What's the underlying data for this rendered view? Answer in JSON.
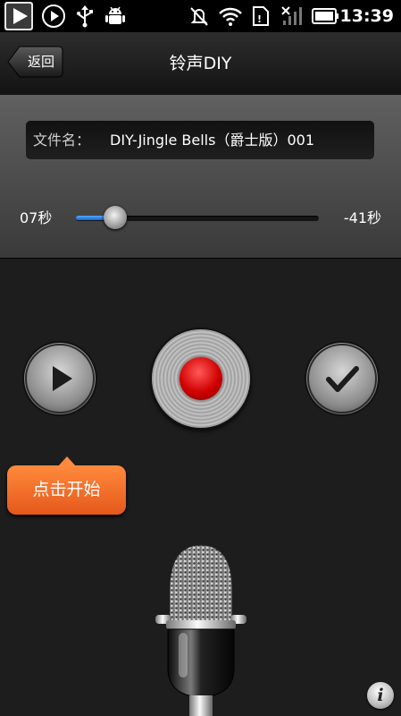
{
  "status_bar": {
    "time": "13:39",
    "icons": [
      "play-store-icon",
      "music-play-icon",
      "usb-icon",
      "android-debug-icon",
      "mute-icon",
      "wifi-icon",
      "sd-card-icon",
      "no-signal-icon",
      "battery-icon"
    ]
  },
  "title_bar": {
    "back_label": "返回",
    "title": "铃声DIY"
  },
  "file": {
    "label": "文件名：",
    "value": "DIY-Jingle Bells（爵士版）001"
  },
  "progress": {
    "elapsed": "07秒",
    "remaining": "-41秒",
    "fraction": 0.16
  },
  "controls": {
    "play_icon": "play-icon",
    "record_icon": "record-icon",
    "confirm_icon": "checkmark-icon"
  },
  "tooltip": {
    "text": "点击开始"
  },
  "info": {
    "glyph": "i"
  },
  "colors": {
    "accent_blue": "#2a7de1",
    "record_red": "#d10000",
    "tooltip_orange": "#f06a25"
  }
}
